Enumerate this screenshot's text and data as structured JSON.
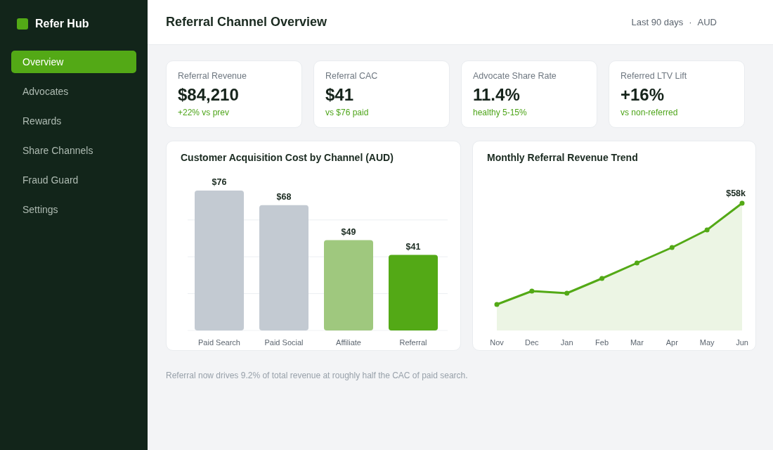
{
  "sidebar": {
    "brand": "Refer Hub",
    "items": [
      {
        "label": "Overview",
        "selected": true
      },
      {
        "label": "Advocates",
        "selected": false
      },
      {
        "label": "Rewards",
        "selected": false
      },
      {
        "label": "Share Channels",
        "selected": false
      },
      {
        "label": "Fraud Guard",
        "selected": false
      },
      {
        "label": "Settings",
        "selected": false
      }
    ]
  },
  "header": {
    "title": "Referral Channel Overview",
    "range": "Last 90 days",
    "separator": "·",
    "currency": "AUD"
  },
  "kpis": [
    {
      "label": "Referral Revenue",
      "value": "$84,210",
      "note": "+22% vs prev"
    },
    {
      "label": "Referral CAC",
      "value": "$41",
      "note": "vs $76 paid"
    },
    {
      "label": "Advocate Share Rate",
      "value": "11.4%",
      "note": "healthy 5-15%"
    },
    {
      "label": "Referred LTV Lift",
      "value": "+16%",
      "note": "vs non-referred"
    }
  ],
  "cac_chart": {
    "chart_data": {
      "type": "bar",
      "title": "Customer Acquisition Cost by Channel (AUD)",
      "categories": [
        "Paid Search",
        "Paid Social",
        "Affiliate",
        "Referral"
      ],
      "series": [
        {
          "color": "#c3cad2",
          "values": [
            76,
            68,
            null,
            null
          ],
          "value_labels": [
            "$76",
            "$68",
            null,
            null
          ]
        },
        {
          "color": "#9fc87e",
          "values": [
            null,
            null,
            49,
            null
          ],
          "value_labels": [
            null,
            null,
            "$49",
            null
          ]
        },
        {
          "color": "#53a916",
          "values": [
            null,
            null,
            null,
            41
          ],
          "value_labels": [
            null,
            null,
            null,
            "$41"
          ]
        }
      ],
      "stacked": true
    }
  },
  "trend_chart": {
    "title": "Monthly Referral Revenue Trend",
    "months": [
      "Nov",
      "Dec",
      "Jan",
      "Feb",
      "Mar",
      "Apr",
      "May",
      "Jun"
    ],
    "end_label": "$58k"
  },
  "footnote": "Referral now drives 9.2% of total revenue at roughly half the CAC of paid search."
}
